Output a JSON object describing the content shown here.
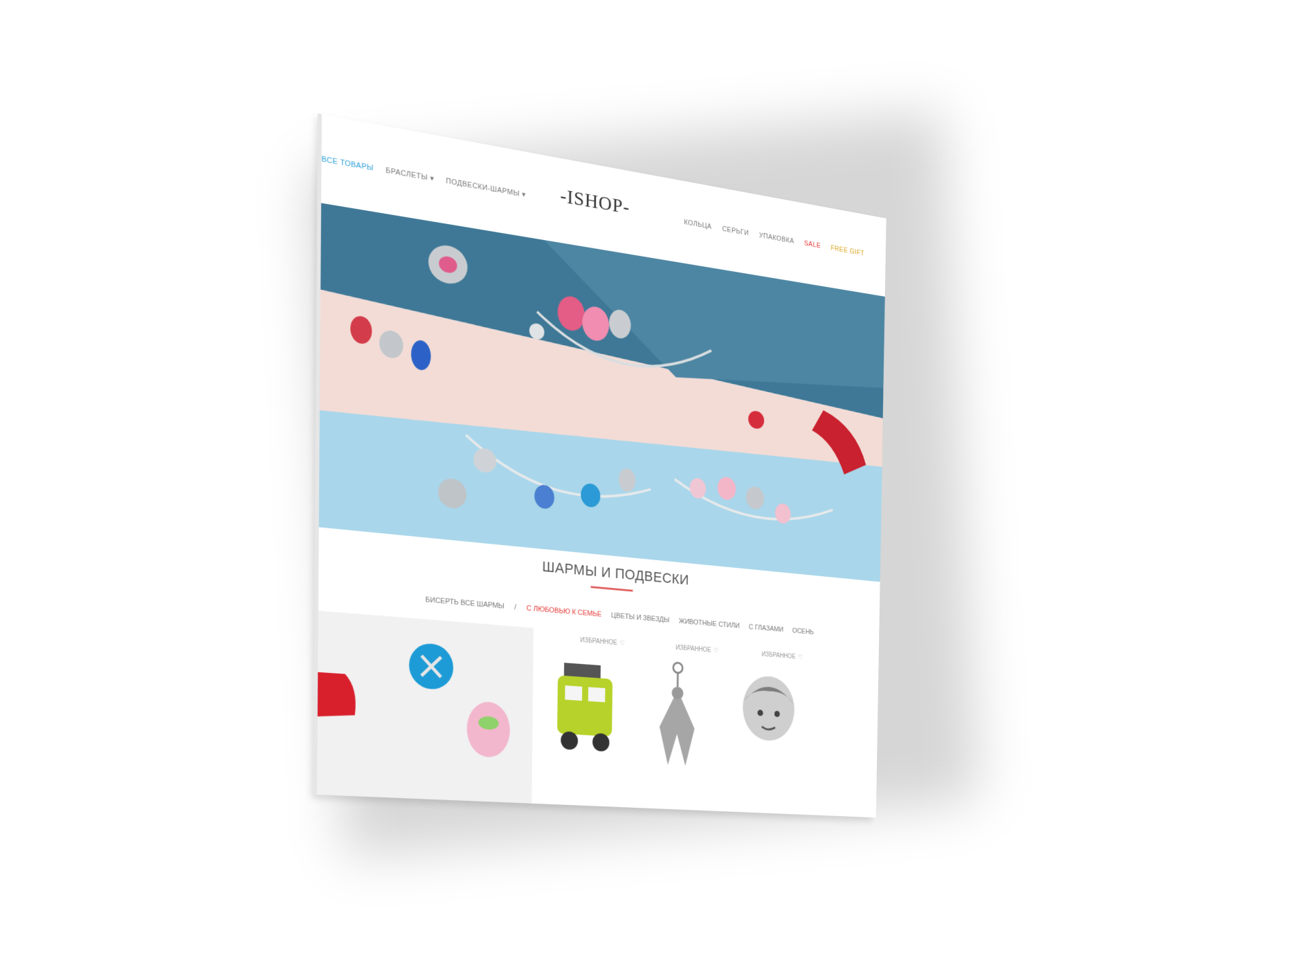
{
  "header": {
    "logo": "-ISHOP-",
    "nav_left": [
      {
        "label": "ВСЕ ТОВАРЫ",
        "state": "active"
      },
      {
        "label": "БРАСЛЕТЫ ▾",
        "state": "normal"
      },
      {
        "label": "ПОДВЕСКИ-ШАРМЫ ▾",
        "state": "normal"
      }
    ],
    "nav_right": [
      {
        "label": "КОЛЬЦА",
        "state": "normal"
      },
      {
        "label": "СЕРЬГИ",
        "state": "normal"
      },
      {
        "label": "УПАКОВКА",
        "state": "normal"
      },
      {
        "label": "SALE",
        "state": "sale"
      },
      {
        "label": "FREE GIFT",
        "state": "gold"
      }
    ]
  },
  "section": {
    "title": "ШАРМЫ И ПОДВЕСКИ",
    "filters": [
      {
        "label": "БИСЕРТЬ ВСЕ ШАРМЫ",
        "state": "normal"
      },
      {
        "label": "/",
        "state": "normal"
      },
      {
        "label": "С ЛЮБОВЬЮ К СЕМЬЕ",
        "state": "active"
      },
      {
        "label": "ЦВЕТЫ И ЗВЕЗДЫ",
        "state": "normal"
      },
      {
        "label": "ЖИВОТНЫЕ СТИЛИ",
        "state": "normal"
      },
      {
        "label": "С ГЛАЗАМИ",
        "state": "normal"
      },
      {
        "label": "ОСЕНЬ",
        "state": "normal"
      }
    ]
  },
  "products": [
    {
      "wishlist": "ИЗБРАННОЕ",
      "icon": "car-charm-icon",
      "accent": "#b7d22a"
    },
    {
      "wishlist": "ИЗБРАННОЕ",
      "icon": "angel-pendant-icon",
      "accent": "#9a9a9a"
    },
    {
      "wishlist": "ИЗБРАННОЕ",
      "icon": "girl-charm-icon",
      "accent": "#8a8a8a"
    }
  ],
  "colors": {
    "accent_blue": "#2c9ed8",
    "sale_red": "#e53935",
    "gold": "#d6a41a",
    "hero_dark_blue": "#3f7896",
    "hero_pink": "#f3dcd6",
    "hero_light_blue": "#a9d6ea"
  }
}
